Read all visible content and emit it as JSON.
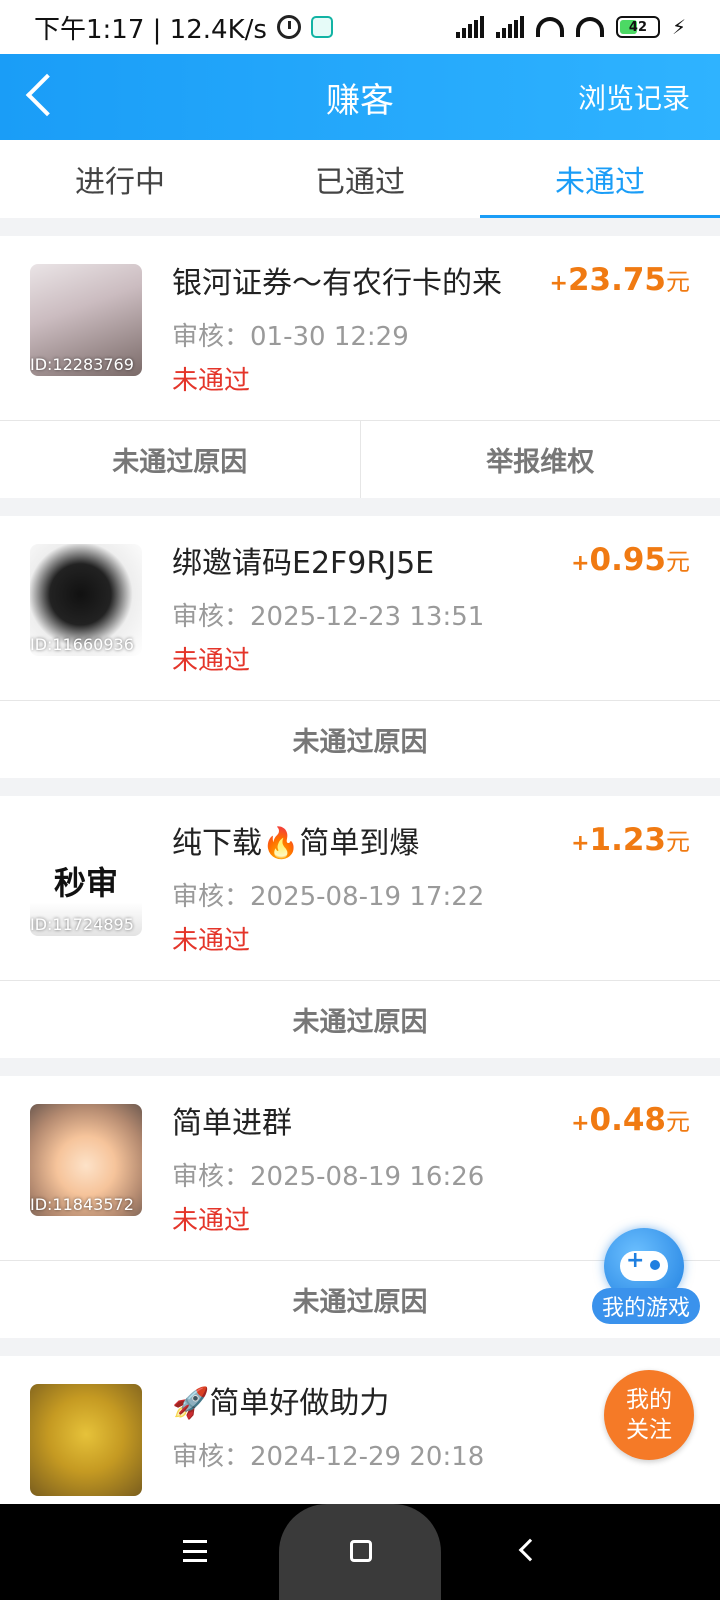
{
  "status_bar": {
    "time": "下午1:17 | 12.4K/s",
    "battery": "42"
  },
  "header": {
    "title": "赚客",
    "right_link": "浏览记录"
  },
  "tabs": [
    {
      "label": "进行中"
    },
    {
      "label": "已通过"
    },
    {
      "label": "未通过",
      "active": true
    }
  ],
  "review_prefix": "审核：",
  "tasks": [
    {
      "title": "银河证券～有农行卡的来",
      "reward_sign": "+",
      "reward_amount": "23.75",
      "reward_unit": "元",
      "review_time": "审核：01-30 12:29",
      "status": "未通过",
      "thumb_id": "ID:12283769",
      "actions": [
        "未通过原因",
        "举报维权"
      ]
    },
    {
      "title": "绑邀请码E2F9RJ5E",
      "reward_sign": "+",
      "reward_amount": "0.95",
      "reward_unit": "元",
      "review_time": "审核：2025-12-23 13:51",
      "status": "未通过",
      "thumb_id": "ID:11660936",
      "actions": [
        "未通过原因"
      ]
    },
    {
      "title": "纯下载🔥简单到爆",
      "reward_sign": "+",
      "reward_amount": "1.23",
      "reward_unit": "元",
      "review_time": "审核：2025-08-19 17:22",
      "status": "未通过",
      "thumb_id": "ID:11724895",
      "thumb_text": "秒审",
      "actions": [
        "未通过原因"
      ]
    },
    {
      "title": "简单进群",
      "reward_sign": "+",
      "reward_amount": "0.48",
      "reward_unit": "元",
      "review_time": "审核：2025-08-19 16:26",
      "status": "未通过",
      "thumb_id": "ID:11843572",
      "actions": [
        "未通过原因"
      ]
    },
    {
      "title": "🚀简单好做助力",
      "reward_sign": "+",
      "reward_amount": "",
      "reward_unit": "",
      "review_time": "审核：2024-12-29 20:18",
      "status": "",
      "thumb_id": "",
      "actions": []
    }
  ],
  "floating": {
    "game_label": "我的游戏",
    "follow_line1": "我的",
    "follow_line2": "关注"
  },
  "colors": {
    "brand_blue": "#1a9df7",
    "reward_orange": "#f07a12",
    "rejected_red": "#e4352a"
  },
  "icons": [
    "back-arrow-icon",
    "clock-icon",
    "signal-icon",
    "wifi-icon",
    "battery-icon",
    "gamepad-icon",
    "menu-icon",
    "home-icon",
    "nav-back-icon"
  ]
}
